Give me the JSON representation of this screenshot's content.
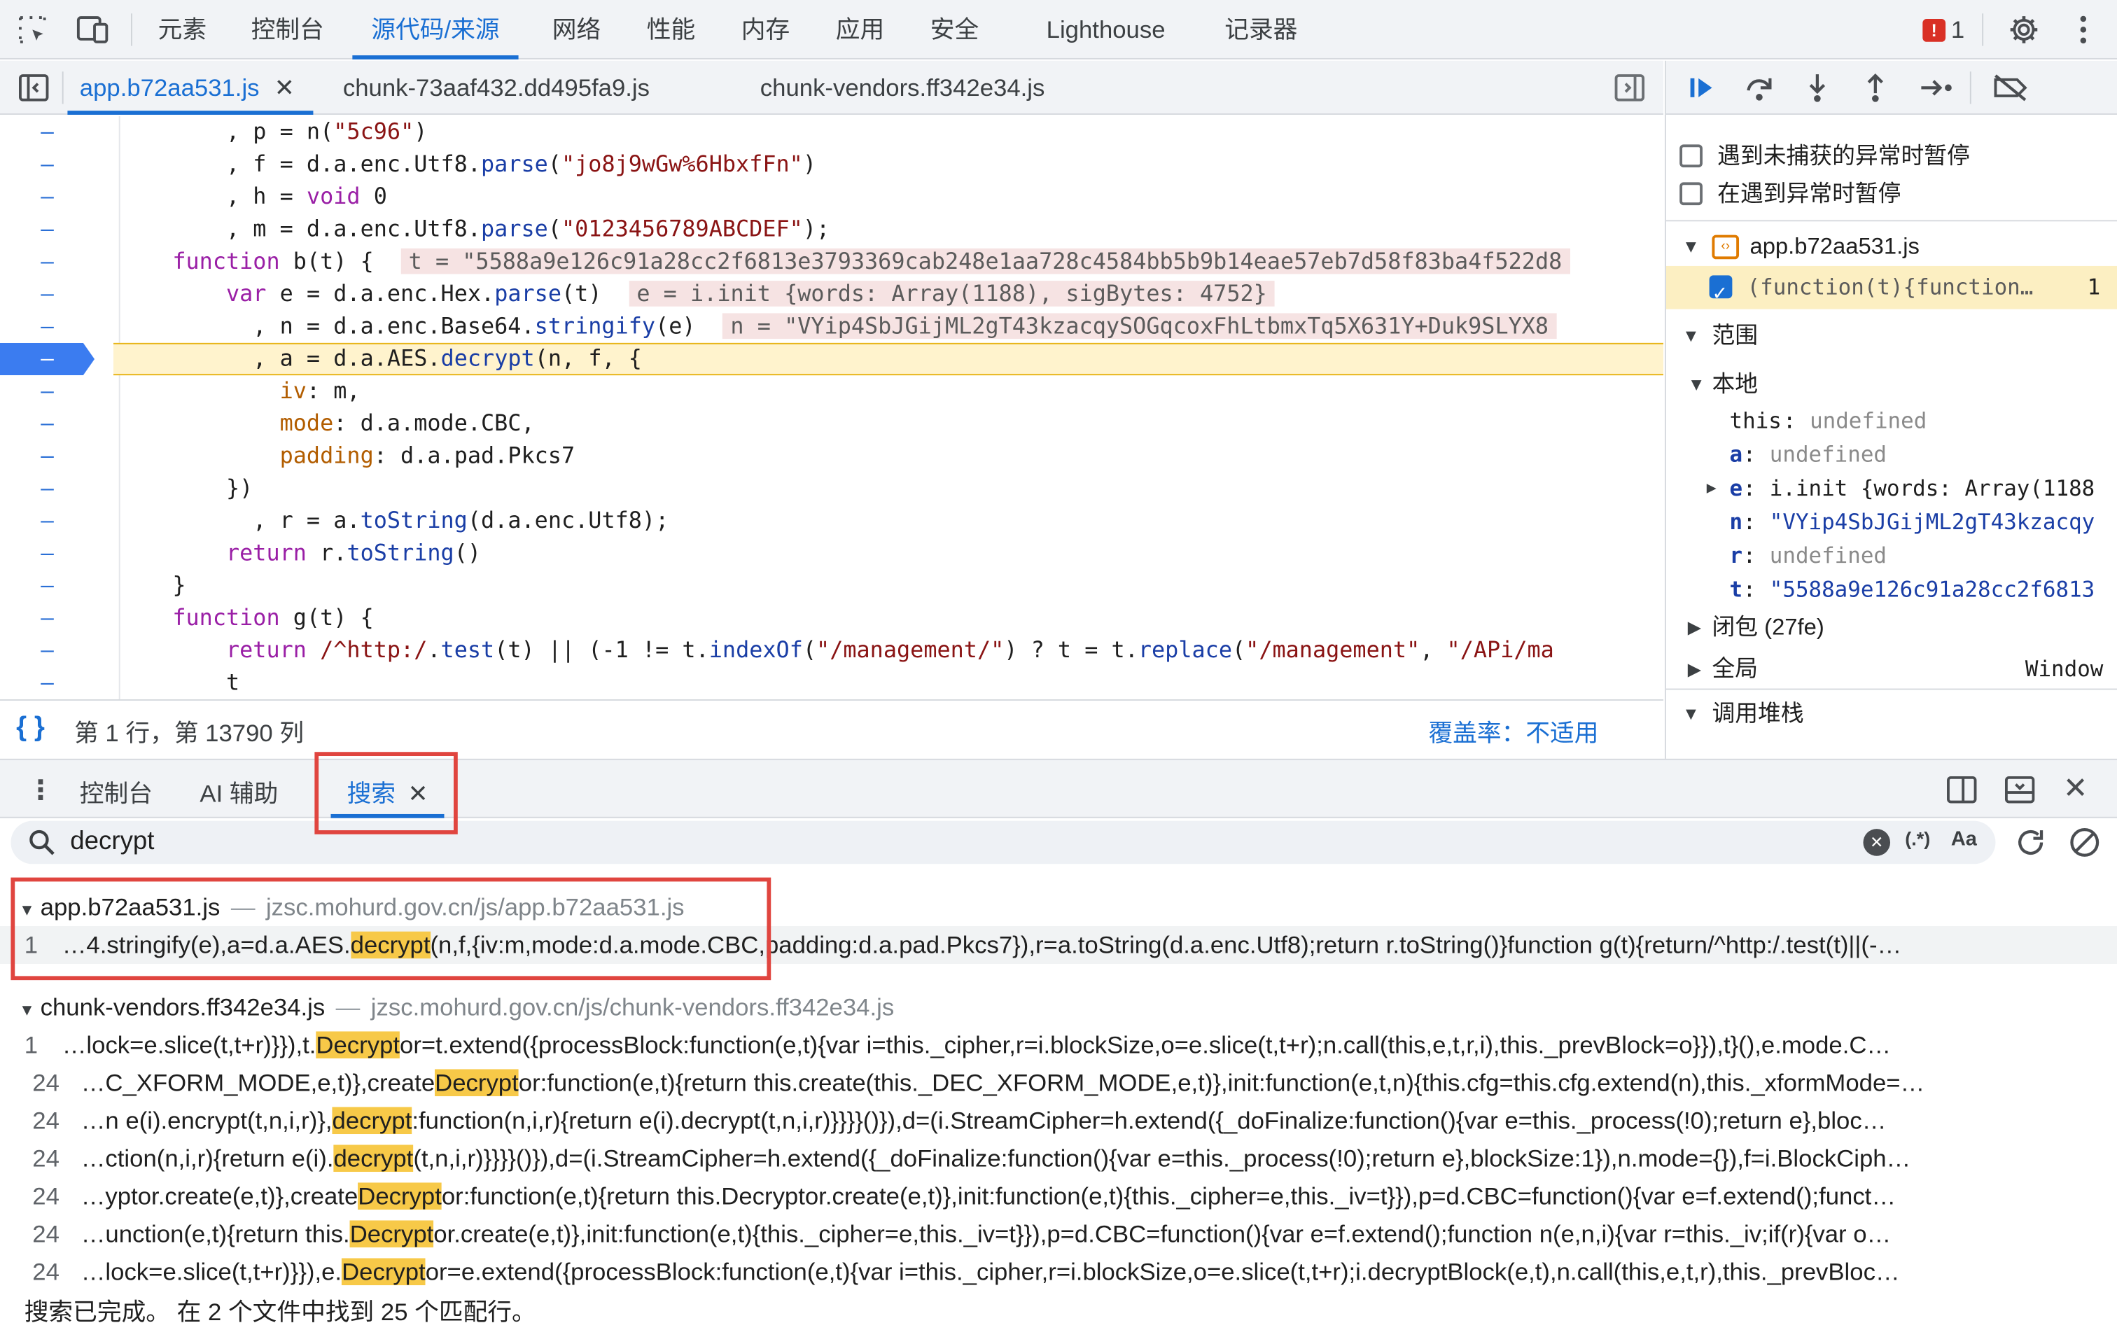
{
  "top_tabs": [
    "元素",
    "控制台",
    "源代码/来源",
    "网络",
    "性能",
    "内存",
    "应用",
    "安全",
    "Lighthouse",
    "记录器"
  ],
  "issues_count": "1",
  "file_tabs": [
    "app.b72aa531.js",
    "chunk-73aaf432.dd495fa9.js",
    "chunk-vendors.ff342e34.js"
  ],
  "code_lines": [
    {
      "parts": [
        [
          "v",
          "        , p = n("
        ],
        [
          "s",
          "\"5c96\""
        ],
        [
          "v",
          ")"
        ]
      ]
    },
    {
      "parts": [
        [
          "v",
          "        , f = d.a.enc.Utf8."
        ],
        [
          "f",
          "parse"
        ],
        [
          "v",
          "("
        ],
        [
          "s",
          "\"jo8j9wGw%6HbxfFn\""
        ],
        [
          "v",
          ")"
        ]
      ]
    },
    {
      "parts": [
        [
          "v",
          "        , h = "
        ],
        [
          "k",
          "void"
        ],
        [
          "v",
          " 0"
        ]
      ]
    },
    {
      "parts": [
        [
          "v",
          "        , m = d.a.enc.Utf8."
        ],
        [
          "f",
          "parse"
        ],
        [
          "v",
          "("
        ],
        [
          "s",
          "\"0123456789ABCDEF\""
        ],
        [
          "v",
          ");"
        ]
      ]
    },
    {
      "parts": [
        [
          "k",
          "    function"
        ],
        [
          "v",
          " b(t) {  "
        ],
        [
          "inl",
          "t = \"5588a9e126c91a28cc2f6813e3793369cab248e1aa728c4584bb5b9b14eae57eb7d58f83ba4f522d8"
        ]
      ]
    },
    {
      "parts": [
        [
          "k",
          "        var"
        ],
        [
          "v",
          " e = d.a.enc.Hex."
        ],
        [
          "f",
          "parse"
        ],
        [
          "v",
          "(t)  "
        ],
        [
          "inl",
          "e = i.init {words: Array(1188), sigBytes: 4752}"
        ]
      ]
    },
    {
      "parts": [
        [
          "v",
          "          , n = d.a.enc.Base64."
        ],
        [
          "f",
          "stringify"
        ],
        [
          "v",
          "(e)  "
        ],
        [
          "inl",
          "n = \"VYip4SbJGijML2gT43kzacqySOGqcoxFhLtbmxTq5X631Y+Duk9SLYX8"
        ]
      ]
    },
    {
      "parts": [
        [
          "v",
          "          , a = "
        ],
        [
          "v",
          "d.a.AES."
        ],
        [
          "f",
          "decrypt"
        ],
        [
          "v",
          "(n, f, {"
        ]
      ]
    },
    {
      "parts": [
        [
          "p",
          "            iv"
        ],
        [
          "v",
          ": m,"
        ]
      ]
    },
    {
      "parts": [
        [
          "p",
          "            mode"
        ],
        [
          "v",
          ": d.a.mode.CBC,"
        ]
      ]
    },
    {
      "parts": [
        [
          "p",
          "            padding"
        ],
        [
          "v",
          ": d.a.pad.Pkcs7"
        ]
      ]
    },
    {
      "parts": [
        [
          "v",
          "        })"
        ]
      ]
    },
    {
      "parts": [
        [
          "v",
          "          , r = a."
        ],
        [
          "f",
          "toString"
        ],
        [
          "v",
          "(d.a.enc.Utf8);"
        ]
      ]
    },
    {
      "parts": [
        [
          "k",
          "        return"
        ],
        [
          "v",
          " r."
        ],
        [
          "f",
          "toString"
        ],
        [
          "v",
          "()"
        ]
      ]
    },
    {
      "parts": [
        [
          "v",
          "    }"
        ]
      ]
    },
    {
      "parts": [
        [
          "k",
          "    function"
        ],
        [
          "v",
          " g(t) {"
        ]
      ]
    },
    {
      "parts": [
        [
          "k",
          "        return"
        ],
        [
          "s",
          " /^http:/"
        ],
        [
          "v",
          "."
        ],
        [
          "f",
          "test"
        ],
        [
          "v",
          "(t) || (-1 != t."
        ],
        [
          "f",
          "indexOf"
        ],
        [
          "v",
          "("
        ],
        [
          "s",
          "\"/management/\""
        ],
        [
          "v",
          ") ? t = t."
        ],
        [
          "f",
          "replace"
        ],
        [
          "v",
          "("
        ],
        [
          "s",
          "\"/management\""
        ],
        [
          "v",
          ", "
        ],
        [
          "s",
          "\"/APi/ma"
        ]
      ]
    },
    {
      "parts": [
        [
          "v",
          "        t"
        ]
      ]
    }
  ],
  "status": {
    "position": "第 1 行，第 13790 列",
    "coverage": "覆盖率：不适用"
  },
  "right_panel": {
    "pause_uncaught": "遇到未捕获的异常时暂停",
    "pause_caught": "在遇到异常时暂停",
    "bp_file": "app.b72aa531.js",
    "bp_code": "(function(t){function…",
    "bp_line": "1",
    "scope_label": "范围",
    "local_label": "本地",
    "scope_vars": [
      {
        "name": "this",
        "value": "undefined",
        "type": "gray"
      },
      {
        "name": "a",
        "value": "undefined",
        "type": "gray"
      },
      {
        "name": "e",
        "value": "i.init {words: Array(1188",
        "type": "plain"
      },
      {
        "name": "n",
        "value": "\"VYip4SbJGijML2gT43kzacqy",
        "type": "str"
      },
      {
        "name": "r",
        "value": "undefined",
        "type": "gray"
      },
      {
        "name": "t",
        "value": "\"5588a9e126c91a28cc2f6813",
        "type": "str"
      }
    ],
    "closure_label": "闭包 (27fe)",
    "global_label": "全局",
    "global_value": "Window",
    "callstack_label": "调用堆栈"
  },
  "drawer_tabs": [
    "控制台",
    "AI 辅助",
    "搜索"
  ],
  "search": {
    "query": "decrypt",
    "regex_label": "(.*)",
    "case_label": "Aa"
  },
  "results": [
    {
      "file": "app.b72aa531.js",
      "path": "jzsc.mohurd.gov.cn/js/app.b72aa531.js",
      "lines": [
        {
          "num": "1",
          "pre": "…4.stringify(e),a=d.a.AES.",
          "match": "decrypt",
          "post": "(n,f,{iv:m,mode:d.a.mode.CBC,padding:d.a.pad.Pkcs7}),r=a.toString(d.a.enc.Utf8);return r.toString()}function g(t){return/^http:/.test(t)||(-…"
        }
      ]
    },
    {
      "file": "chunk-vendors.ff342e34.js",
      "path": "jzsc.mohurd.gov.cn/js/chunk-vendors.ff342e34.js",
      "lines": [
        {
          "num": "1",
          "pre": "…lock=e.slice(t,t+r)}}),t.",
          "match": "Decrypt",
          "post": "or=t.extend({processBlock:function(e,t){var i=this._cipher,r=i.blockSize,o=e.slice(t,t+r);n.call(this,e,t,r,i),this._prevBlock=o}}),t}(),e.mode.C…"
        },
        {
          "num": "24",
          "pre": "…C_XFORM_MODE,e,t)},create",
          "match": "Decrypt",
          "post": "or:function(e,t){return this.create(this._DEC_XFORM_MODE,e,t)},init:function(e,t,n){this.cfg=this.cfg.extend(n),this._xformMode=…"
        },
        {
          "num": "24",
          "pre": "…n e(i).encrypt(t,n,i,r)},",
          "match": "decrypt",
          "post": ":function(n,i,r){return e(i).decrypt(t,n,i,r)}}}}()}),d=(i.StreamCipher=h.extend({_doFinalize:function(){var e=this._process(!0);return e},bloc…"
        },
        {
          "num": "24",
          "pre": "…ction(n,i,r){return e(i).",
          "match": "decrypt",
          "post": "(t,n,i,r)}}}}()}),d=(i.StreamCipher=h.extend({_doFinalize:function(){var e=this._process(!0);return e},blockSize:1}),n.mode={}),f=i.BlockCiph…"
        },
        {
          "num": "24",
          "pre": "…yptor.create(e,t)},create",
          "match": "Decrypt",
          "post": "or:function(e,t){return this.Decryptor.create(e,t)},init:function(e,t){this._cipher=e,this._iv=t}}),p=d.CBC=function(){var e=f.extend();funct…"
        },
        {
          "num": "24",
          "pre": "…unction(e,t){return this.",
          "match": "Decrypt",
          "post": "or.create(e,t)},init:function(e,t){this._cipher=e,this._iv=t}}),p=d.CBC=function(){var e=f.extend();function n(e,n,i){var r=this._iv;if(r){var o…"
        },
        {
          "num": "24",
          "pre": "…lock=e.slice(t,t+r)}}),e.",
          "match": "Decrypt",
          "post": "or=e.extend({processBlock:function(e,t){var i=this._cipher,r=i.blockSize,o=e.slice(t,t+r);i.decryptBlock(e,t),n.call(this,e,t,r),this._prevBloc…"
        }
      ]
    }
  ],
  "footer": "搜索已完成。 在 2 个文件中找到 25 个匹配行。",
  "colors": {
    "accent": "#1a6fd3",
    "highlight": "#f7c948",
    "red_annotation": "#e0453f",
    "paused_line": "#fff3cd"
  }
}
